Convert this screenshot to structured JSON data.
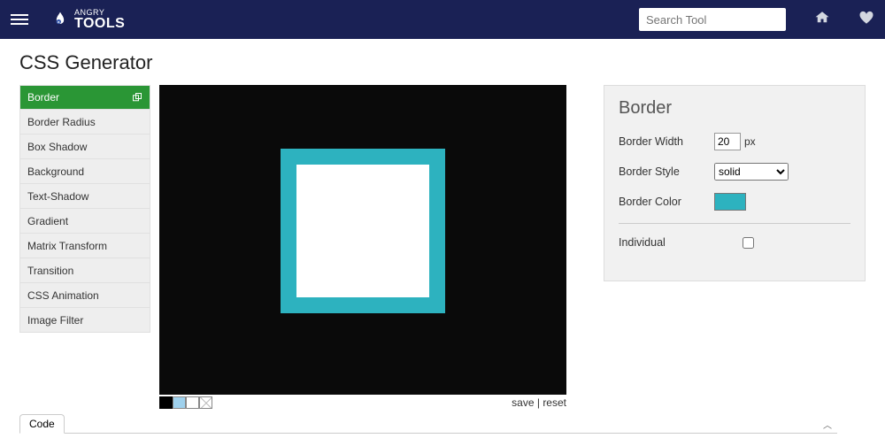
{
  "brand": {
    "top": "ANGRY",
    "bottom": "TOOLS"
  },
  "search": {
    "placeholder": "Search Tool"
  },
  "page_title": "CSS Generator",
  "sidebar": {
    "items": [
      "Border",
      "Border Radius",
      "Box Shadow",
      "Background",
      "Text-Shadow",
      "Gradient",
      "Matrix Transform",
      "Transition",
      "CSS Animation",
      "Image Filter"
    ]
  },
  "actions": {
    "save": "save",
    "reset": "reset"
  },
  "panel": {
    "title": "Border",
    "width_label": "Border Width",
    "width_value": "20",
    "width_unit": "px",
    "style_label": "Border Style",
    "style_value": "solid",
    "color_label": "Border Color",
    "color_value": "#2db2bf",
    "individual_label": "Individual"
  },
  "code_tab": "Code"
}
